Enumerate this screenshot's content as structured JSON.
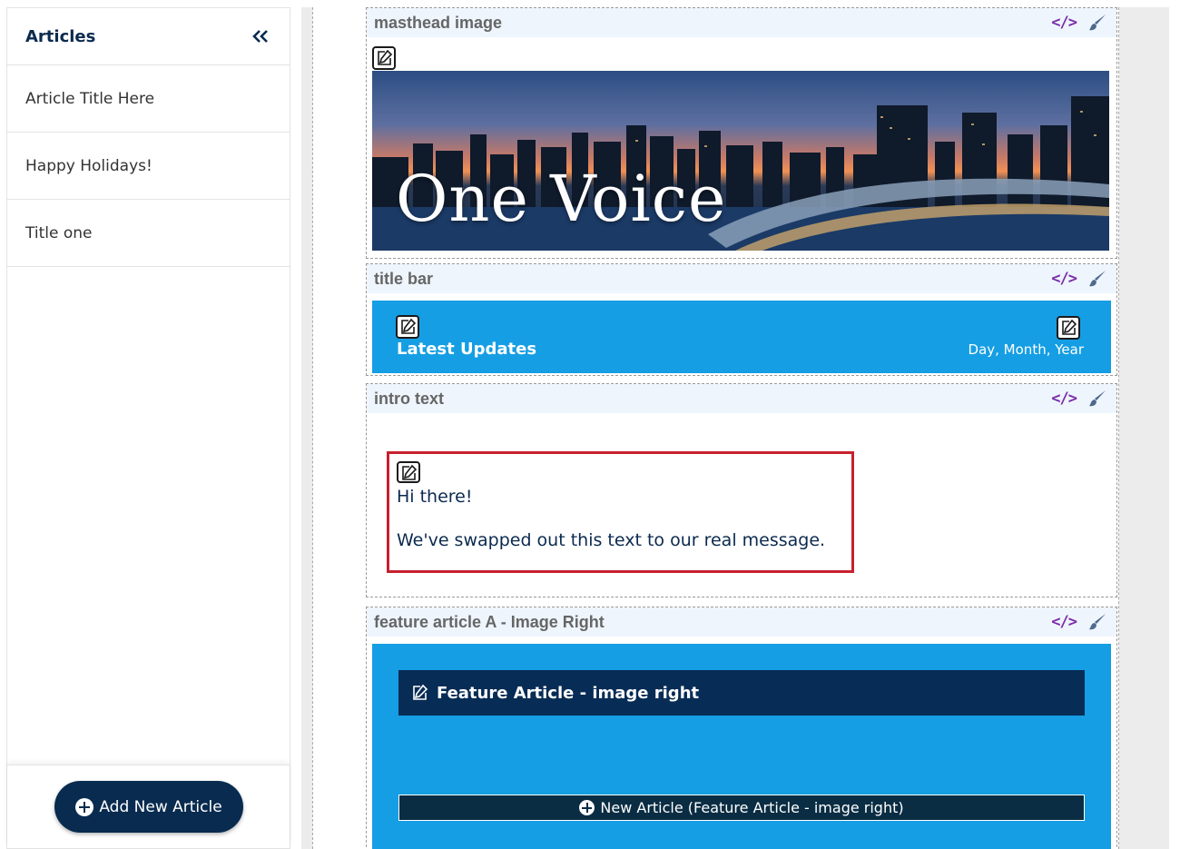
{
  "sidebar": {
    "title": "Articles",
    "items": [
      {
        "label": "Article Title Here"
      },
      {
        "label": "Happy Holidays!"
      },
      {
        "label": "Title one"
      }
    ],
    "add_button_label": "Add New Article"
  },
  "blocks": {
    "masthead": {
      "label": "masthead image",
      "hero_text": "One Voice"
    },
    "title_bar": {
      "label": "title bar",
      "left_text": "Latest Updates",
      "right_text": "Day, Month, Year"
    },
    "intro": {
      "label": "intro text",
      "line1": "Hi there!",
      "line2": "We've swapped out this text to our real message."
    },
    "feature": {
      "label": "feature article A - Image Right",
      "heading": "Feature Article - image right",
      "new_button_label": "New Article (Feature Article - image right)"
    }
  },
  "icons": {
    "code": "</>",
    "brush": "brush-icon",
    "edit": "edit-icon",
    "collapse": "double-chevron-left-icon",
    "plus": "plus-circle-icon"
  },
  "colors": {
    "navy": "#082b4f",
    "accent_blue": "#159ee4",
    "code_icon_purple": "#7a2aa8",
    "selection_red": "#c8202e"
  }
}
